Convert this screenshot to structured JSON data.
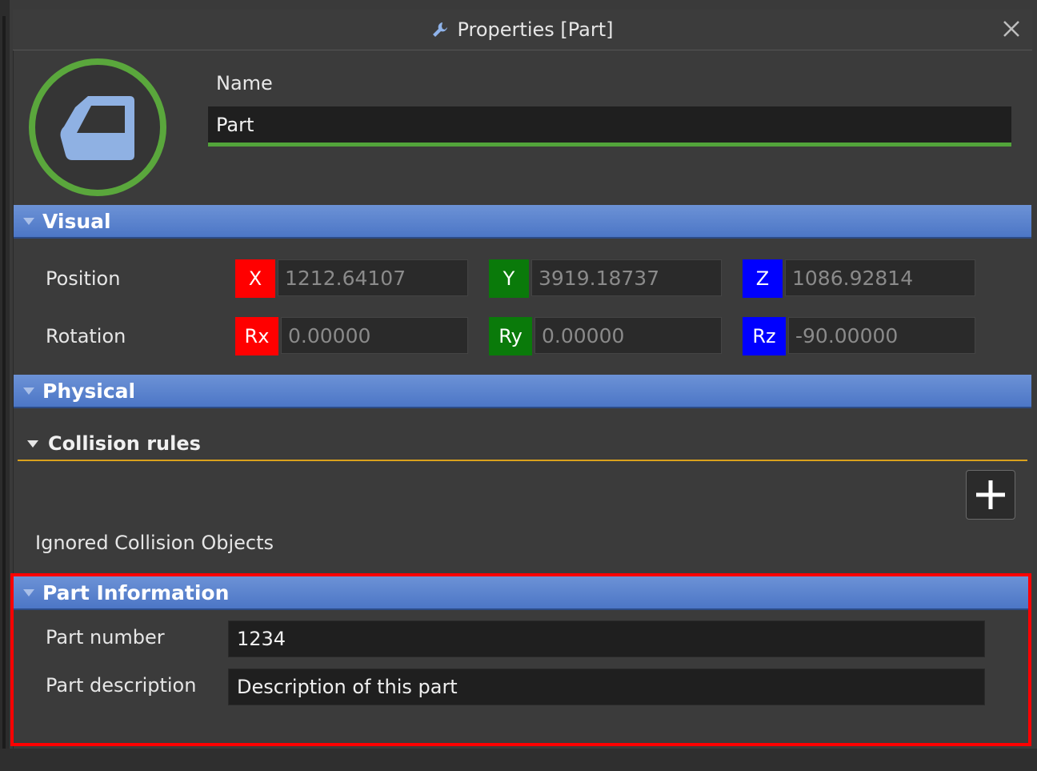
{
  "window": {
    "title": "Properties [Part]",
    "title_icon": "wrench-icon",
    "close_icon": "close-icon"
  },
  "header": {
    "avatar_icon": "part-door-icon",
    "name_label": "Name",
    "name_value": "Part"
  },
  "visual": {
    "title": "Visual",
    "position_label": "Position",
    "rotation_label": "Rotation",
    "position": [
      {
        "axis": "X",
        "value": "1212.64107",
        "color": "#ff0000"
      },
      {
        "axis": "Y",
        "value": "3919.18737",
        "color": "#0a7a0a"
      },
      {
        "axis": "Z",
        "value": "1086.92814",
        "color": "#0000ff"
      }
    ],
    "rotation": [
      {
        "axis": "Rx",
        "value": "0.00000",
        "color": "#ff0000"
      },
      {
        "axis": "Ry",
        "value": "0.00000",
        "color": "#0a7a0a"
      },
      {
        "axis": "Rz",
        "value": "-90.00000",
        "color": "#0000ff"
      }
    ]
  },
  "physical": {
    "title": "Physical",
    "collision_rules_title": "Collision rules",
    "add_icon": "plus-icon",
    "ignored_label": "Ignored Collision Objects"
  },
  "part_information": {
    "title": "Part Information",
    "part_number_label": "Part number",
    "part_number_value": "1234",
    "part_description_label": "Part description",
    "part_description_value": "Description of this part"
  },
  "colors": {
    "section_header": "#5a82cc",
    "name_underline": "#52a43a",
    "collision_underline": "#d9a11d",
    "highlight": "#ff0000"
  }
}
